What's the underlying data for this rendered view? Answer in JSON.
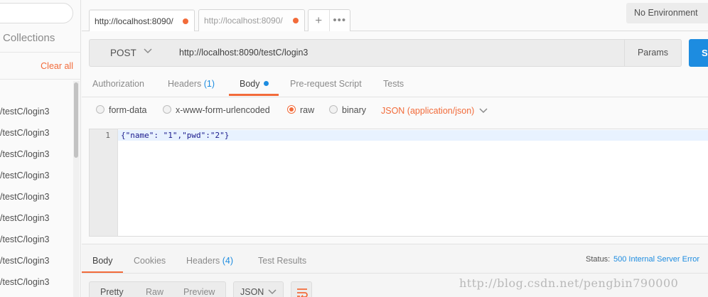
{
  "sidebar": {
    "tab_label": "Collections",
    "clear_all": "Clear all",
    "history": [
      "/testC/login3",
      "/testC/login3",
      "/testC/login3",
      "/testC/login3",
      "/testC/login3",
      "/testC/login3",
      "/testC/login3",
      "/testC/login3",
      "/testC/login3"
    ]
  },
  "tabs": [
    {
      "label": "http://localhost:8090/",
      "active": true
    },
    {
      "label": "http://localhost:8090/",
      "active": false
    }
  ],
  "tab_actions": {
    "add": "+",
    "more": "•••"
  },
  "environment": "No Environment",
  "request": {
    "method": "POST",
    "url": "http://localhost:8090/testC/login3",
    "params_label": "Params",
    "send_label": "Se"
  },
  "request_tabs": {
    "authorization": "Authorization",
    "headers": "Headers",
    "headers_count": "(1)",
    "body": "Body",
    "prerequest": "Pre-request Script",
    "tests": "Tests"
  },
  "body_types": {
    "form_data": "form-data",
    "urlencoded": "x-www-form-urlencoded",
    "raw": "raw",
    "binary": "binary",
    "selected": "raw",
    "content_type": "JSON (application/json)"
  },
  "editor": {
    "lines": [
      {
        "number": "1",
        "code": "{\"name\": \"1\",\"pwd\":\"2\"}"
      }
    ]
  },
  "response": {
    "tabs": {
      "body": "Body",
      "cookies": "Cookies",
      "headers": "Headers",
      "headers_count": "(4)",
      "test_results": "Test Results"
    },
    "status_label": "Status:",
    "status_value": "500 Internal Server Error",
    "view_modes": {
      "pretty": "Pretty",
      "raw": "Raw",
      "preview": "Preview"
    },
    "format": "JSON"
  },
  "watermark": "http://blog.csdn.net/pengbin790000",
  "colors": {
    "accent_orange": "#f26b3a",
    "accent_blue": "#1d8ce0"
  }
}
